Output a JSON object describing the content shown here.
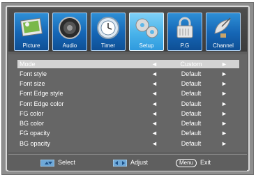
{
  "tabs": [
    {
      "label": "Picture",
      "icon": "picture-icon"
    },
    {
      "label": "Audio",
      "icon": "speaker-icon"
    },
    {
      "label": "Timer",
      "icon": "clock-icon"
    },
    {
      "label": "Setup",
      "icon": "gears-icon",
      "active": true
    },
    {
      "label": "P.G",
      "icon": "lock-icon"
    },
    {
      "label": "Channel",
      "icon": "satellite-dish-icon"
    }
  ],
  "menu": {
    "rows": [
      {
        "label": "Mode",
        "value": "Custom",
        "left": "◄",
        "right": "►"
      },
      {
        "label": "Font style",
        "value": "Default",
        "left": "◄",
        "right": "►"
      },
      {
        "label": "Font size",
        "value": "Default",
        "left": "◄",
        "right": "►"
      },
      {
        "label": "Font Edge style",
        "value": "Default",
        "left": "◄",
        "right": "►"
      },
      {
        "label": "Font Edge color",
        "value": "Default",
        "left": "◄",
        "right": "►"
      },
      {
        "label": "FG color",
        "value": "Default",
        "left": "◄",
        "right": "►"
      },
      {
        "label": "BG color",
        "value": "Default",
        "left": "◄",
        "right": "►"
      },
      {
        "label": "FG opacity",
        "value": "Default",
        "left": "◄",
        "right": "►"
      },
      {
        "label": "BG opacity",
        "value": "Default",
        "left": "◄",
        "right": "►"
      }
    ]
  },
  "footer": {
    "select_label": "Select",
    "adjust_label": "Adjust",
    "menu_key": "Menu",
    "exit_label": "Exit"
  },
  "colors": {
    "accent": "#2f9ade",
    "selected_row": "#d3d3d3",
    "background": "#5f5f5f"
  }
}
